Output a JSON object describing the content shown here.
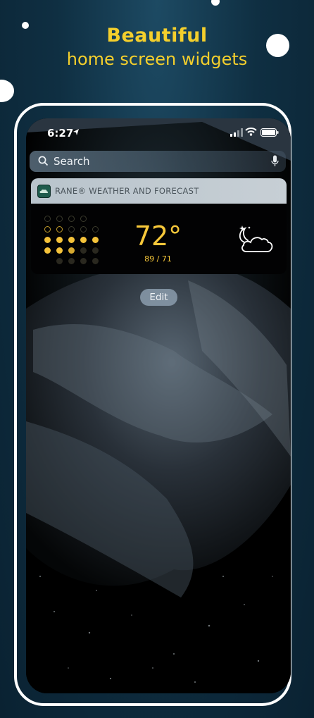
{
  "headline": {
    "title": "Beautiful",
    "subtitle": "home screen widgets"
  },
  "colors": {
    "accent": "#f4cf2c",
    "background": "#0f2f42",
    "widget_text": "#f7c83a"
  },
  "status_bar": {
    "time": "6:27",
    "icons": [
      "location-arrow-icon",
      "signal-icon",
      "wifi-icon",
      "battery-icon"
    ]
  },
  "search": {
    "placeholder": "Search",
    "icons": [
      "search-icon",
      "microphone-icon"
    ]
  },
  "widget": {
    "app_name": "RANE® WEATHER AND FORECAST",
    "temperature": "72°",
    "high_low": "89 / 71",
    "condition_icon": "partly-cloudy-night-icon"
  },
  "edit": {
    "label": "Edit"
  }
}
